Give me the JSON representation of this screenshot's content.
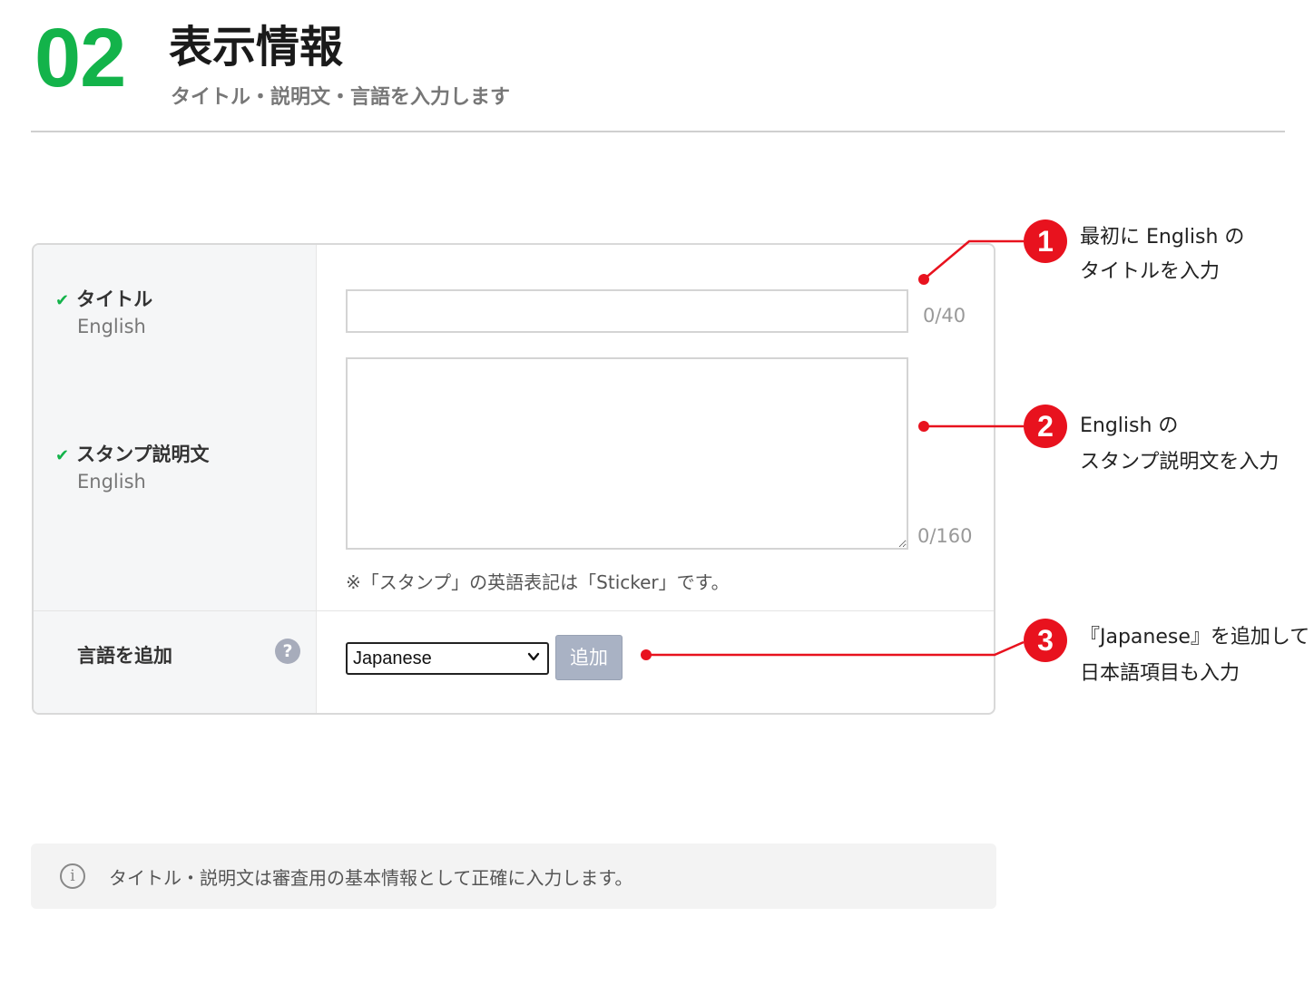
{
  "header": {
    "step_number": "02",
    "title": "表示情報",
    "subtitle": "タイトル・説明文・言語を入力します"
  },
  "form": {
    "title_field": {
      "label": "タイトル",
      "lang": "English",
      "value": "",
      "counter": "0/40"
    },
    "description_field": {
      "label": "スタンプ説明文",
      "lang": "English",
      "value": "",
      "counter": "0/160",
      "note": "※「スタンプ」の英語表記は「Sticker」です。"
    },
    "language_row": {
      "label": "言語を追加",
      "help_symbol": "?",
      "selected": "Japanese",
      "add_button": "追加"
    }
  },
  "annotations": [
    {
      "number": "1",
      "line1": "最初に English の",
      "line2": "タイトルを入力"
    },
    {
      "number": "2",
      "line1": "English の",
      "line2": "スタンプ説明文を入力"
    },
    {
      "number": "3",
      "line1": "『Japanese』を追加して",
      "line2": "日本語項目も入力"
    }
  ],
  "notice": {
    "icon_symbol": "i",
    "text": "タイトル・説明文は審査用の基本情報として正確に入力します。"
  },
  "colors": {
    "step_green": "#13b34a",
    "annotation_red": "#e8121e",
    "button_gray": "#a9b2c4"
  },
  "icons": {
    "check": "check-icon",
    "help": "question-icon",
    "info": "info-icon",
    "select": "chevron-down-icon"
  }
}
